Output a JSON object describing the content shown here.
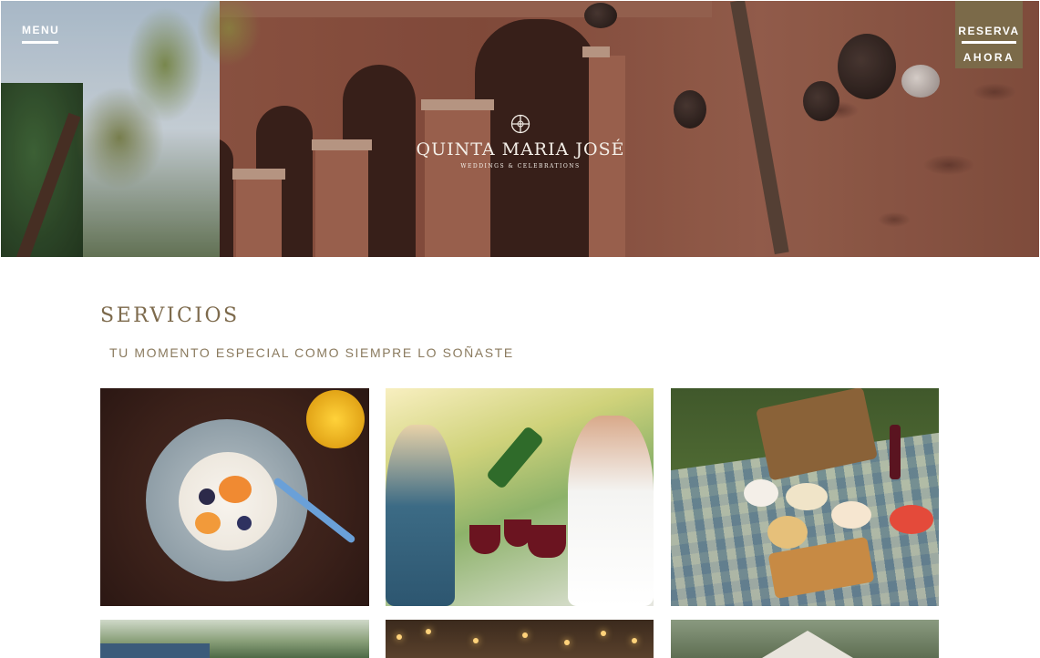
{
  "header": {
    "menu_label": "MENU",
    "reserve_line1": "RESERVA",
    "reserve_line2": "AHORA"
  },
  "hero": {
    "logo_name": "QUINTA MARIA JOSÉ",
    "logo_tagline": "WEDDINGS & CELEBRATIONS",
    "logo_icon": "cross-circle-icon"
  },
  "services": {
    "title": "SERVICIOS",
    "subtitle": "TU MOMENTO ESPECIAL COMO SIEMPRE LO SOÑASTE",
    "cards": [
      {
        "image": "plated-dish-photo"
      },
      {
        "image": "wine-toast-photo"
      },
      {
        "image": "picnic-spread-photo"
      },
      {
        "image": "garden-lawn-photo"
      },
      {
        "image": "string-lights-photo"
      },
      {
        "image": "garden-tent-photo"
      }
    ]
  },
  "colors": {
    "accent": "#7b6a49",
    "title": "#7d6a4c",
    "subtitle": "#8a7a5e"
  }
}
